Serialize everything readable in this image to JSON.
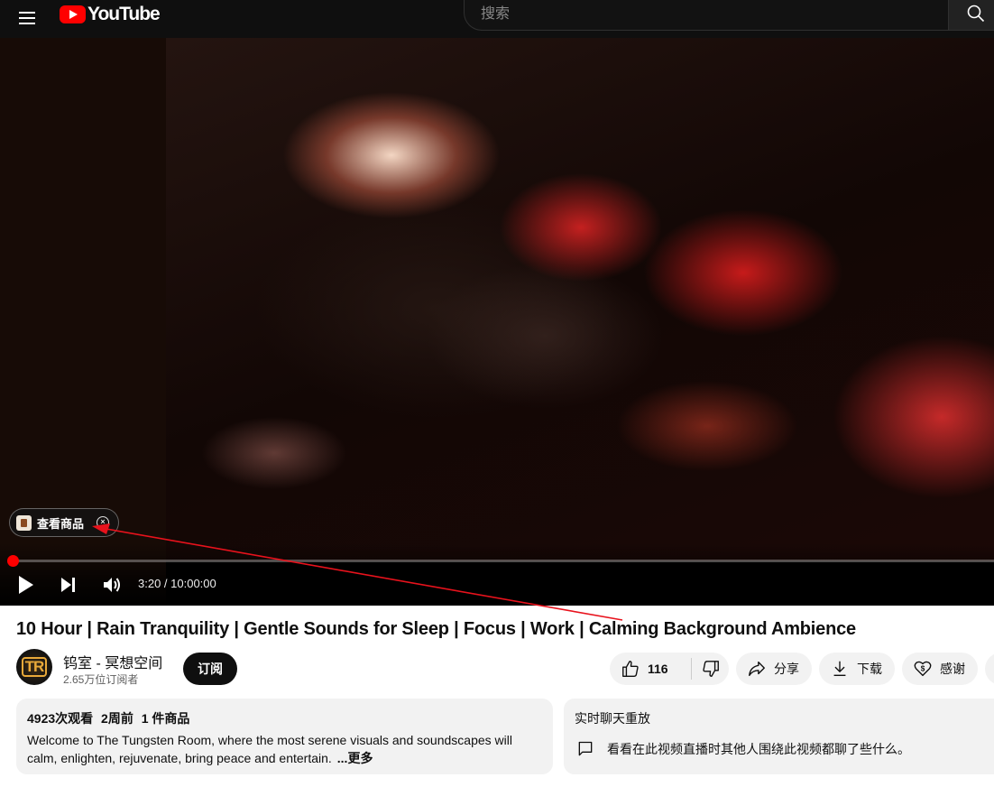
{
  "header": {
    "brand": "YouTube",
    "search_placeholder": "搜索"
  },
  "player": {
    "product_chip_label": "查看商品",
    "time_current": "3:20",
    "time_total": "10:00:00",
    "time_display": "3:20 / 10:00:00",
    "progress_fraction": 0.00056
  },
  "video": {
    "title": "10 Hour | Rain Tranquility | Gentle Sounds for Sleep | Focus | Work | Calming Background Ambience"
  },
  "channel": {
    "name": "钨室 - 冥想空间",
    "subscribers": "2.65万位订阅者",
    "avatar_text": "TR",
    "subscribe_label": "订阅"
  },
  "actions": {
    "like_count": "116",
    "share_label": "分享",
    "download_label": "下载",
    "thanks_label": "感谢"
  },
  "description": {
    "views": "4923次观看",
    "age": "2周前",
    "products": "1 件商品",
    "text": "Welcome to The Tungsten Room,  where the most serene visuals and soundscapes will calm, enlighten, rejuvenate, bring peace and entertain.",
    "more_label": "...更多"
  },
  "live_chat": {
    "title": "实时聊天重放",
    "message": "看看在此视频直播时其他人围绕此视频都聊了些什么。"
  },
  "colors": {
    "brand_red": "#ff0000",
    "annotation_red": "#e8121c"
  }
}
